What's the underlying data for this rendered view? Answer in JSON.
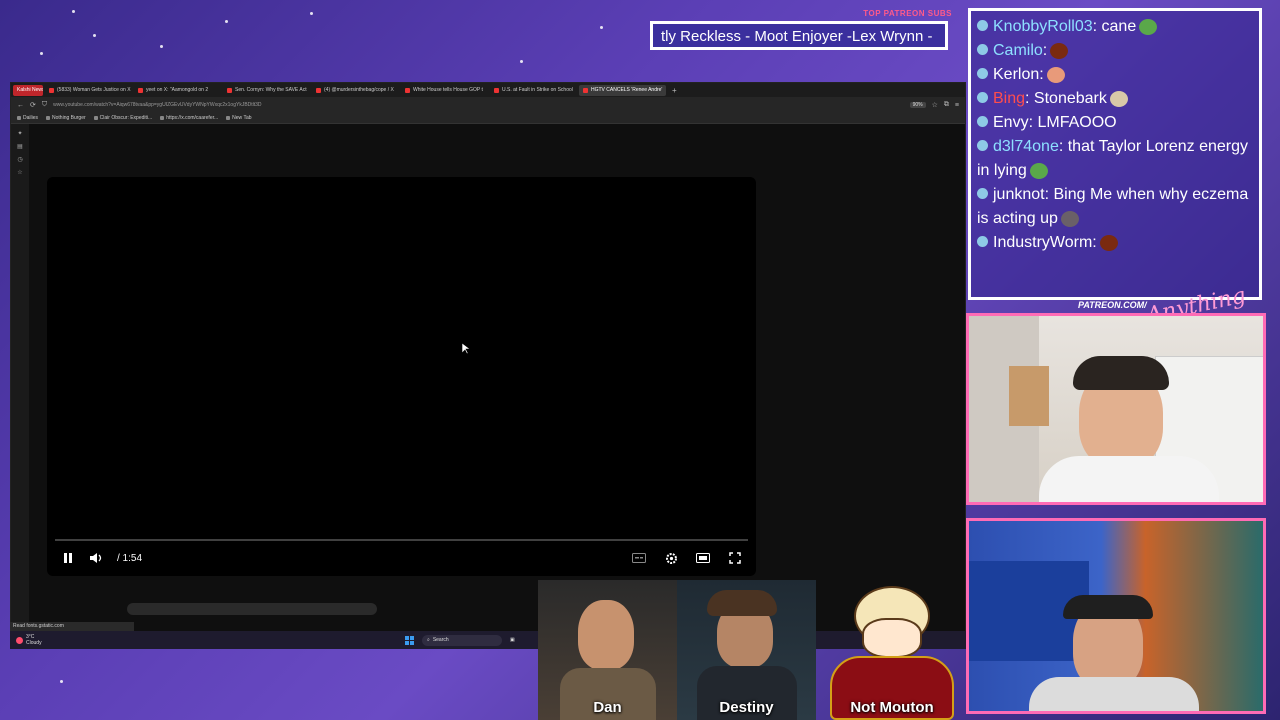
{
  "ticker": {
    "label": "TOP PATREON SUBS",
    "text": "tly Reckless - Moot Enjoyer -Lex Wrynn -"
  },
  "browser": {
    "tabs": [
      {
        "label": "Kalshi News",
        "kind": "kalshi"
      },
      {
        "label": "(5833) Woman Gets Justice on X"
      },
      {
        "label": "yeet on X: \"Aamongold on 2"
      },
      {
        "label": "Sen. Cornyn: Why the SAVE Act"
      },
      {
        "label": "(4) @murdersinthebag/cope / X"
      },
      {
        "label": "White House tells House GOP t"
      },
      {
        "label": "U.S. at Fault in Strike on School"
      },
      {
        "label": "HGTV CANCELS 'Renee Andre'",
        "active": true
      }
    ],
    "url": "www.youtube.com/watch?v=Aiqw678tvaa&pp=ygUIZGEvUVdyYWNpYWxqc2x1ogYkJBDtlt3D",
    "zoom": "90%",
    "bookmarks": [
      "Dailies",
      "Nothing Burger",
      "Clair Obscur: Expediti...",
      "https://x.com/caarefer...",
      "New Tab"
    ],
    "status": "Read fonts.gstatic.com"
  },
  "player": {
    "time": "/ 1:54"
  },
  "taskbar": {
    "temp": "3°C",
    "weather": "Cloudy",
    "search": "Search"
  },
  "cams": {
    "dan": "Dan",
    "destiny": "Destiny",
    "mouton": "Not Mouton"
  },
  "chat": {
    "messages": [
      {
        "user": "KnobbyRoll03",
        "text": ": cane",
        "emote": "frog",
        "color": "#8ee0ff"
      },
      {
        "user": "Camilo",
        "text": ":",
        "emote": "orb",
        "color": "#8ee0ff"
      },
      {
        "user": "Kerlon",
        "text": ":",
        "emote": "face",
        "color": "#ffffff"
      },
      {
        "user": "Bing",
        "text": ": Stonebark",
        "emote": "sticker",
        "color": "#ff4d4d"
      },
      {
        "user": "Envy",
        "text": ": LMFAOOO",
        "color": "#ffffff"
      },
      {
        "user": "d3l74one",
        "text": ": that Taylor Lorenz energy in lying",
        "emote": "frog",
        "color": "#8ee0ff"
      },
      {
        "user": "junknot",
        "text": ": Bing Me when why eczema is acting up",
        "emote": "rock",
        "color": "#ffffff"
      },
      {
        "user": "IndustryWorm",
        "text": ":",
        "emote": "orb",
        "color": "#ffffff"
      }
    ]
  },
  "overlay": {
    "patreon_url": "PATREON.COM/",
    "signature": "Anything Else?"
  },
  "colors": {
    "accent_pink": "#ff6bb5",
    "accent_cyan": "#00e5ff",
    "bg_purple": "#5b3fb5"
  }
}
